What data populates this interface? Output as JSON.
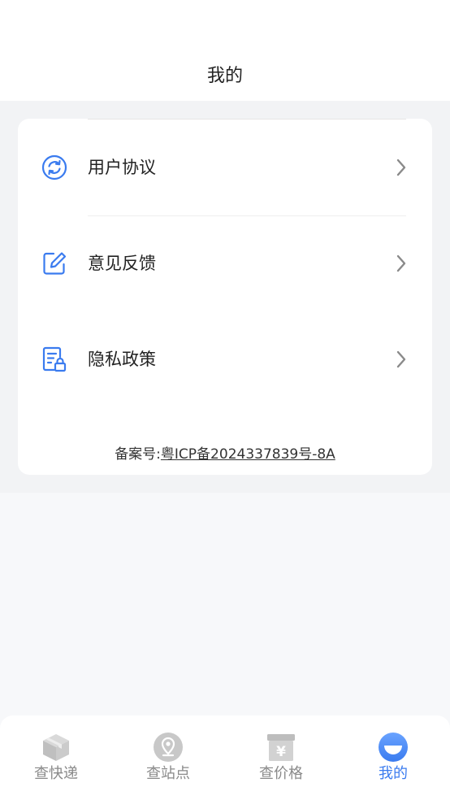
{
  "header": {
    "title": "我的"
  },
  "menu": [
    {
      "label": "用户协议",
      "icon": "refresh-circle-icon"
    },
    {
      "label": "意见反馈",
      "icon": "edit-icon"
    },
    {
      "label": "隐私政策",
      "icon": "document-lock-icon"
    }
  ],
  "filing": {
    "prefix": "备案号:",
    "number": "粤ICP备2024337839号-8A"
  },
  "tabs": [
    {
      "label": "查快递",
      "icon": "package-icon",
      "active": false
    },
    {
      "label": "查站点",
      "icon": "location-pin-icon",
      "active": false
    },
    {
      "label": "查价格",
      "icon": "price-box-icon",
      "active": false
    },
    {
      "label": "我的",
      "icon": "profile-icon",
      "active": true
    }
  ],
  "colors": {
    "accent": "#3a7bef",
    "inactive": "#bfbfbf"
  }
}
